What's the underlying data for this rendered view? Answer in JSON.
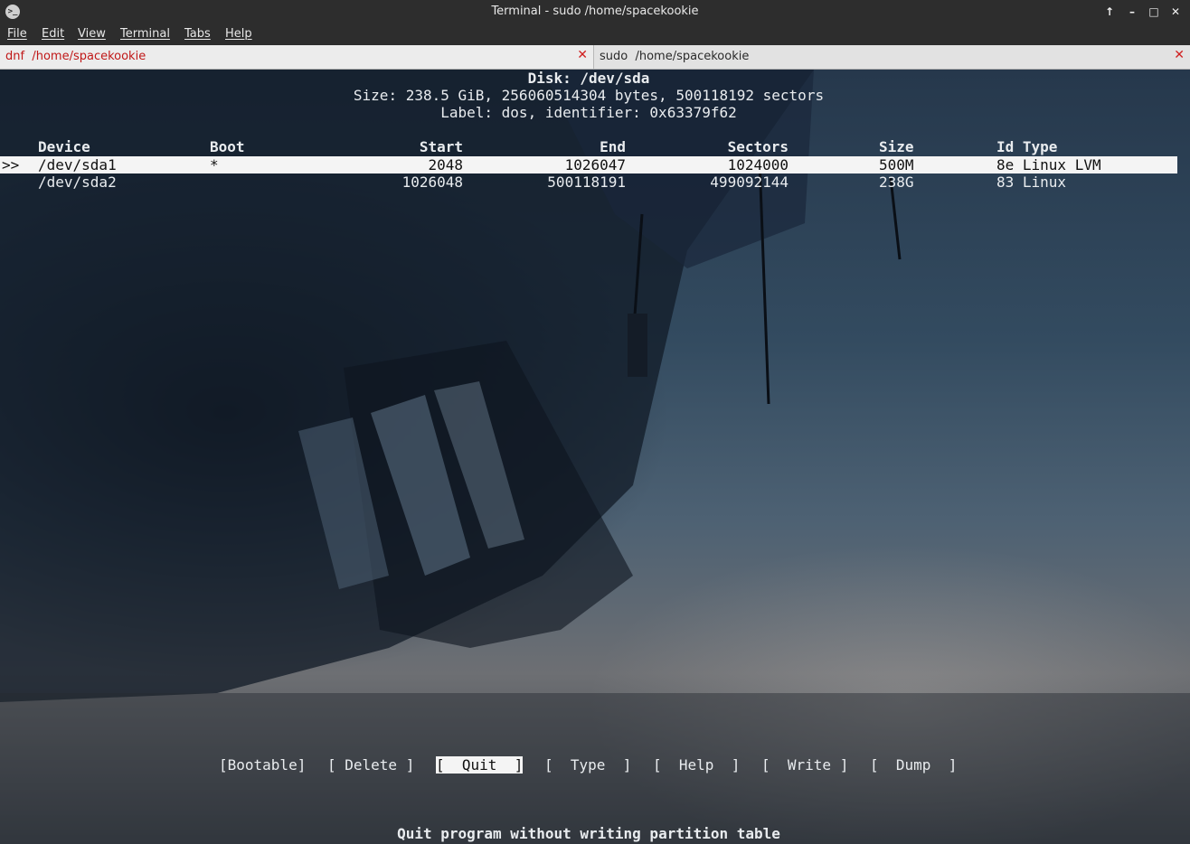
{
  "window": {
    "title": "Terminal - sudo  /home/spacekookie",
    "app_icon": "terminal-icon",
    "controls": [
      "arrow-up-icon",
      "minimize-icon",
      "maximize-icon",
      "close-icon"
    ],
    "control_glyphs": {
      "up": "↑",
      "min": "–",
      "max": "□",
      "close": "✕"
    }
  },
  "menu": [
    "File",
    "Edit",
    "View",
    "Terminal",
    "Tabs",
    "Help"
  ],
  "tabs": [
    {
      "label": "dnf  /home/spacekookie",
      "close": "✕",
      "active": true
    },
    {
      "label": "sudo  /home/spacekookie",
      "close": "✕",
      "active": false
    }
  ],
  "cfdisk": {
    "disk_title": "Disk: /dev/sda",
    "size_line": "Size: 238.5 GiB, 256060514304 bytes, 500118192 sectors",
    "label_line": "Label: dos, identifier: 0x63379f62",
    "columns": [
      "Device",
      "Boot",
      "Start",
      "End",
      "Sectors",
      "Size",
      "Id Type"
    ],
    "selection_marker": ">>",
    "partitions": [
      {
        "device": "/dev/sda1",
        "boot": "*",
        "start": "2048",
        "end": "1026047",
        "sectors": "1024000",
        "size": "500M",
        "id_type": "8e Linux LVM",
        "selected": true
      },
      {
        "device": "/dev/sda2",
        "boot": "",
        "start": "1026048",
        "end": "500118191",
        "sectors": "499092144",
        "size": "238G",
        "id_type": "83 Linux",
        "selected": false
      }
    ],
    "actions": [
      "[Bootable]",
      "[ Delete ]",
      "[  Quit  ]",
      "[  Type  ]",
      "[  Help  ]",
      "[  Write ]",
      "[  Dump  ]"
    ],
    "selected_action": "[  Quit  ]",
    "hint": "Quit program without writing partition table"
  },
  "colors": {
    "accent_tab": "#c01818",
    "tab_close": "#d02020",
    "chrome": "#2d2d2d",
    "highlight": "#f4f4f4"
  }
}
